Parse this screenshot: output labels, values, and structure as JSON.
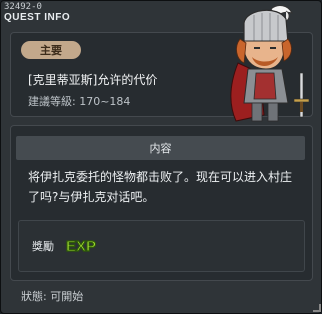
{
  "window": {
    "quest_id": "32492-0",
    "header": "QUEST INFO"
  },
  "quest": {
    "tag": "主要",
    "title": "[克里蒂亚斯]允许的代价",
    "level": "建議等級: 170~184"
  },
  "content": {
    "header": "内容",
    "text": "将伊扎克委托的怪物都击败了。现在可以进入村庄了吗?与伊扎克对话吧。"
  },
  "reward": {
    "label": "獎勵",
    "icon": "exp-icon",
    "icon_text": "EXP"
  },
  "status": {
    "text": "狀態: 可開始"
  },
  "npc": {
    "icon": "knight-npc-portrait"
  }
}
